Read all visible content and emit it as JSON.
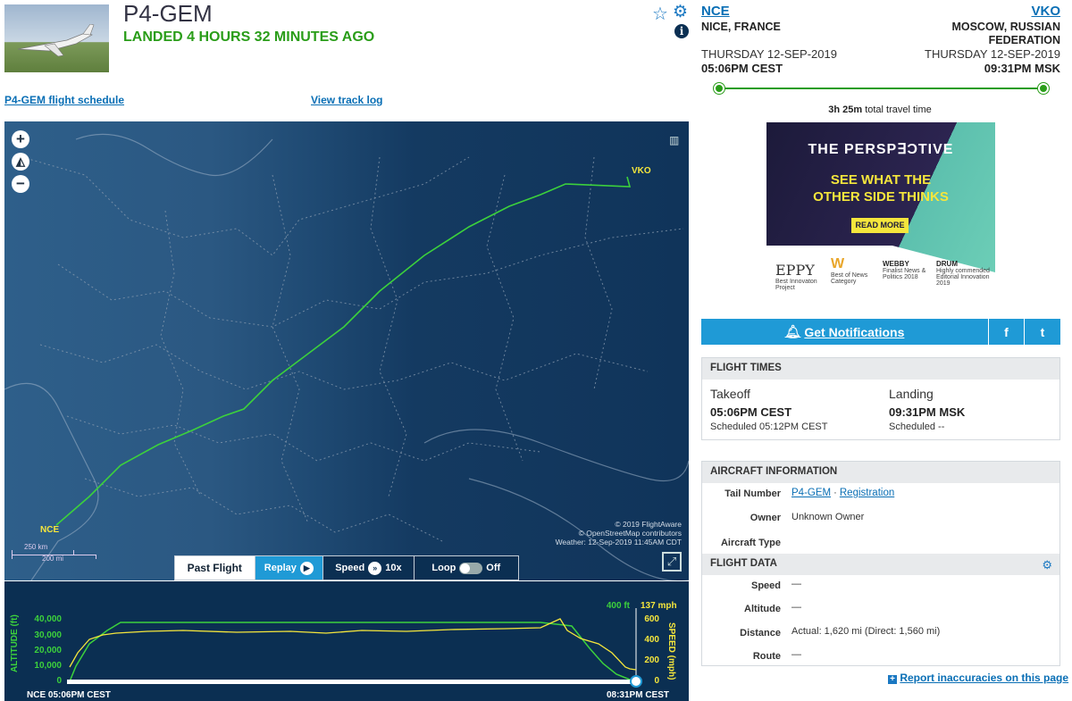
{
  "header": {
    "registration": "P4-GEM",
    "status": "LANDED 4 HOURS 32 MINUTES AGO",
    "schedule_link": "P4-GEM flight schedule",
    "track_link": "View track log"
  },
  "route": {
    "origin": {
      "code": "NCE",
      "city": "NICE, FRANCE",
      "date": "THURSDAY 12-SEP-2019",
      "time": "05:06PM CEST"
    },
    "destination": {
      "code": "VKO",
      "city1": "MOSCOW, RUSSIAN",
      "city2": "FEDERATION",
      "date": "THURSDAY 12-SEP-2019",
      "time": "09:31PM MSK"
    },
    "travel_bold": "3h 25m",
    "travel_rest": " total travel time"
  },
  "map": {
    "origin_label": "NCE",
    "dest_label": "VKO",
    "attrib1": "© 2019 FlightAware",
    "attrib2": "© OpenStreetMap contributors",
    "attrib3": "Weather: 12-Sep-2019 11:45AM CDT",
    "scale_km": "250 km",
    "scale_mi": "200 mi",
    "controls": {
      "past": "Past Flight",
      "replay": "Replay",
      "speed": "Speed",
      "speed_val": "10x",
      "loop": "Loop",
      "loop_val": "Off"
    }
  },
  "altitude_chart": {
    "alt_axis": "ALTITUDE (ft)",
    "speed_axis": "SPEED (mph)",
    "alt_ticks": [
      "40,000",
      "30,000",
      "20,000",
      "10,000",
      "0"
    ],
    "speed_ticks": [
      "600",
      "400",
      "200",
      "0"
    ],
    "cur_alt": "400 ft",
    "cur_speed": "137 mph",
    "start": "NCE 05:06PM CEST",
    "end": "08:31PM CEST"
  },
  "ad": {
    "brand": "THE PERSP∃ƆTIVE",
    "line1": "SEE WHAT THE",
    "line2": "OTHER SIDE THINKS",
    "cta": "READ MORE",
    "awards": [
      {
        "name": "EPPY",
        "cap": "Best Innovaton Project"
      },
      {
        "name": "W",
        "cap": "Best of News Category"
      },
      {
        "name": "WEBBY",
        "cap": "Finalist News & Politics 2018"
      },
      {
        "name": "DRUM",
        "cap": "Highly commended Editorial Innovation 2019"
      }
    ]
  },
  "notify": {
    "label": "Get Notifications",
    "fb": "f",
    "tw": "t"
  },
  "flight_times": {
    "title": "FLIGHT TIMES",
    "takeoff_label": "Takeoff",
    "takeoff_time": "05:06PM CEST",
    "takeoff_sched": "Scheduled 05:12PM CEST",
    "landing_label": "Landing",
    "landing_time": "09:31PM MSK",
    "landing_sched": "Scheduled --"
  },
  "aircraft": {
    "title": "AIRCRAFT INFORMATION",
    "tail_label": "Tail Number",
    "tail_value": "P4-GEM",
    "reg_link": "Registration",
    "owner_label": "Owner",
    "owner_value": "Unknown Owner",
    "type_label": "Aircraft Type"
  },
  "flight_data": {
    "title": "FLIGHT DATA",
    "speed_label": "Speed",
    "speed_value": "—",
    "alt_label": "Altitude",
    "alt_value": "—",
    "dist_label": "Distance",
    "dist_value": "Actual: 1,620 mi (Direct: 1,560 mi)",
    "route_label": "Route",
    "route_value": "—"
  },
  "report_link": "Report inaccuracies on this page",
  "colors": {
    "accent": "#1f9ad6",
    "status": "#2a9d19",
    "navy": "#0b2f52",
    "track": "#3cd13c"
  }
}
